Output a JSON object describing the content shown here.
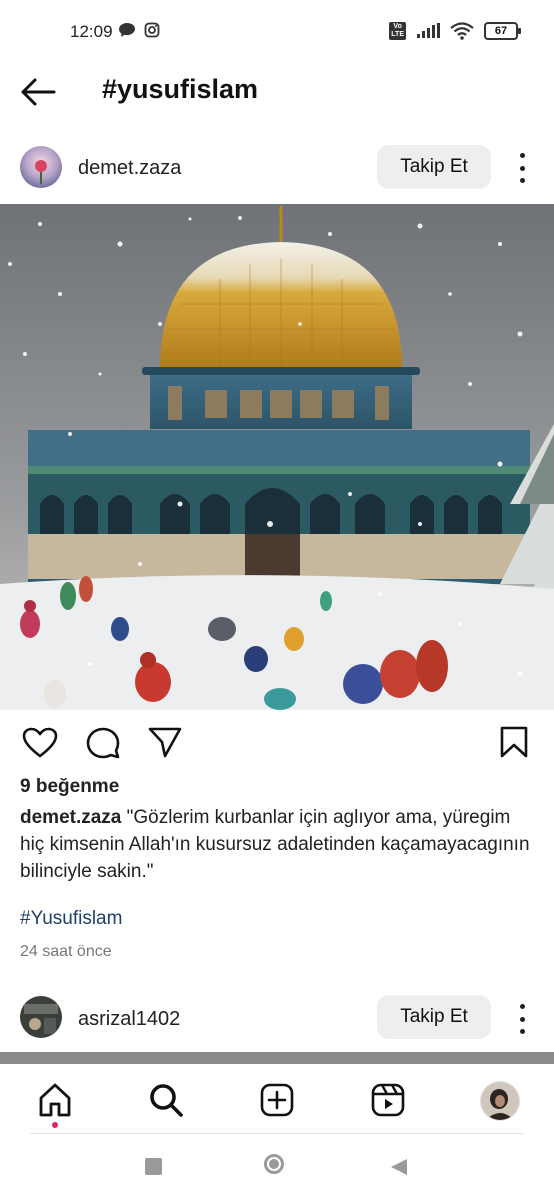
{
  "status_bar": {
    "time": "12:09",
    "left_icons": [
      "chat-bubble-icon",
      "instagram-icon"
    ],
    "network_badge": "VoLTE",
    "battery": "67"
  },
  "header": {
    "title": "#yusufislam",
    "back_icon": "arrow-left-icon"
  },
  "post1": {
    "username": "demet.zaza",
    "follow_label": "Takip Et",
    "likes": "9 beğenme",
    "caption_user": "demet.zaza",
    "caption_text": " \"Gözlerim kurbanlar için aglıyor ama, yüregim hiç kimsenin Allah'ın kusursuz adaletinden kaçamayacagının bilinciyle sakin.\"",
    "hashtag": "#Yusufislam",
    "time_ago": "24 saat önce"
  },
  "post2": {
    "username": "asrizal1402",
    "follow_label": "Takip Et"
  },
  "bottom_nav": [
    "home-icon",
    "search-icon",
    "create-post-icon",
    "reels-icon",
    "profile-avatar"
  ],
  "system_nav": [
    "recents-square-icon",
    "home-circle-icon",
    "back-triangle-icon"
  ],
  "colors": {
    "accent_hashtag": "#1f3f6b",
    "notification_dot": "#e0245e",
    "follow_button_bg": "#eeeeee"
  }
}
